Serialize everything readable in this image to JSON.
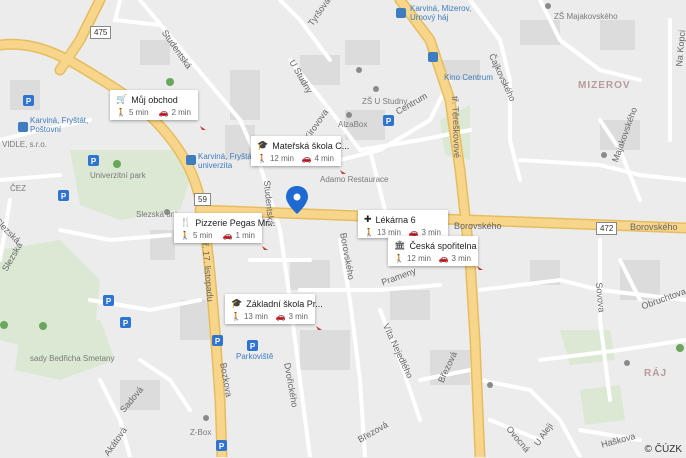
{
  "streets": {
    "studentska_n": "Studentská",
    "tyrsova": "Tyršova",
    "u_studny": "U Studny",
    "kirovova": "Kirovova",
    "centrum": "Centrum",
    "terezinkova": "tř. Těreškovové",
    "cajkovskeho": "Čajkovského",
    "na_kopci": "Na Kopci",
    "majakovskeho": "Majakovského",
    "studentska_mid": "Studentská",
    "borovskeho_w": "Borovského",
    "borovskeho_e": "Borovského",
    "borovskeho_v": "Borovského",
    "prameny": "Prameny",
    "sovova": "Sovova",
    "obruchtova": "Obruchtova",
    "vita_nejedleho": "Víta Nejedlého",
    "brezova": "Březová",
    "brezova2": "Březová",
    "dvorickeho": "Dvořického",
    "bozkova": "Bozkova",
    "tr17": "tř. 17. listopadu",
    "sadova": "Sadová",
    "akatova": "Akátová",
    "u_aleji": "U Aleji",
    "ovocna": "Ovocná",
    "haskova": "Haškova",
    "slezska_n": "Slezská",
    "slezska_w": "Slezská"
  },
  "districts": {
    "mizerov": "MIZEROV",
    "raj": "RÁJ",
    "vidle": "VIDLE, s.r.o."
  },
  "places": {
    "karvina_mizerov": "Karviná, Mizerov,\nUrnový háj",
    "zs_majakovskeho": "ZŠ Majakovského",
    "kino_centrum": "Kino Centrum",
    "zs_u_studny": "ZŠ U Studny",
    "albert": "AlzaBox",
    "karvina_frystat_postovni": "Karviná, Fryštát,\nPoštovní",
    "karvina_frystat_univerzita": "Karviná, Fryštát,\nuniverzita",
    "adamo": "Adamo Restaurace",
    "univerzitni_park": "Univerzitní park",
    "slezska_univerzita": "Slezská uni...",
    "sady": "sady Bedřicha Smetany",
    "parkoviste": "Parkoviště",
    "zbox": "Z-Box",
    "cez": "ČEZ"
  },
  "roads": {
    "r475": "475",
    "r59": "59",
    "r472": "472"
  },
  "cards": [
    {
      "title": "Můj obchod",
      "icon": "cart-icon",
      "walk": "5 min",
      "drive": "2 min"
    },
    {
      "title": "Mateřská škola C...",
      "icon": "graduation-cap-icon",
      "walk": "12 min",
      "drive": "4 min"
    },
    {
      "title": "Pizzerie Pegas Mr...",
      "icon": "restaurant-icon",
      "walk": "5 min",
      "drive": "1 min"
    },
    {
      "title": "Lékárna 6",
      "icon": "pharmacy-icon",
      "walk": "13 min",
      "drive": "3 min"
    },
    {
      "title": "Česká spořitelna",
      "icon": "bank-icon",
      "walk": "12 min",
      "drive": "3 min"
    },
    {
      "title": "Základní škola Pr...",
      "icon": "graduation-cap-icon",
      "walk": "13 min",
      "drive": "3 min"
    }
  ],
  "copyright": "© ČÚZK",
  "colors": {
    "background": "#ececec",
    "major_road": "#f7d58a",
    "major_road_edge": "#e6bd5e",
    "minor_road": "#ffffff",
    "park": "#dbe8d3",
    "building": "#d9d9d9",
    "marker": "#1e6ad3",
    "transit": "#3f7cc0",
    "parking": "#2f74d0"
  }
}
